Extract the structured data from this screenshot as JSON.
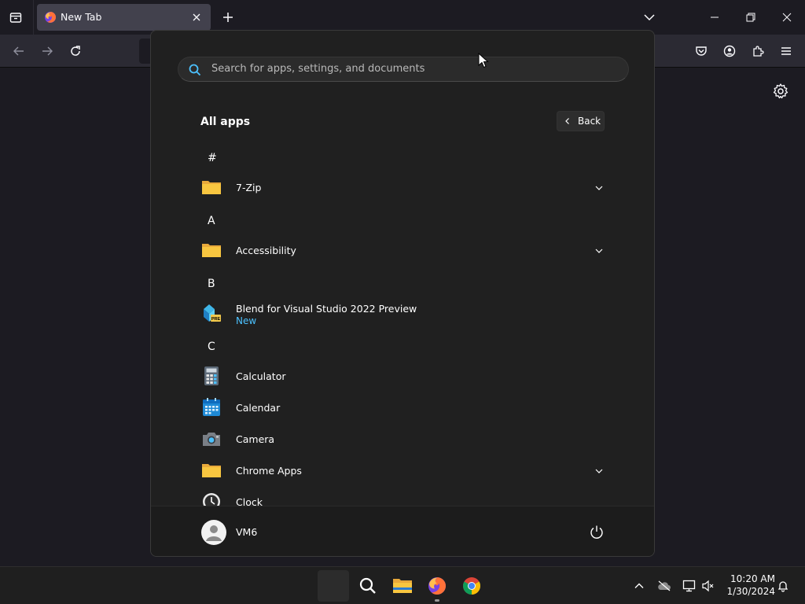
{
  "browser": {
    "tab_title": "New Tab"
  },
  "start_menu": {
    "search_placeholder": "Search for apps, settings, and documents",
    "section_title": "All apps",
    "back_label": "Back",
    "groups": [
      {
        "letter": "#",
        "apps": [
          {
            "name": "7-Zip",
            "icon": "folder-icon",
            "expandable": true
          }
        ]
      },
      {
        "letter": "A",
        "apps": [
          {
            "name": "Accessibility",
            "icon": "folder-icon",
            "expandable": true
          }
        ]
      },
      {
        "letter": "B",
        "apps": [
          {
            "name": "Blend for Visual Studio 2022 Preview",
            "sub": "New",
            "icon": "blend-icon",
            "expandable": false
          }
        ]
      },
      {
        "letter": "C",
        "apps": [
          {
            "name": "Calculator",
            "icon": "calculator-icon",
            "expandable": false
          },
          {
            "name": "Calendar",
            "icon": "calendar-icon",
            "expandable": false
          },
          {
            "name": "Camera",
            "icon": "camera-icon",
            "expandable": false
          },
          {
            "name": "Chrome Apps",
            "icon": "folder-icon",
            "expandable": true
          },
          {
            "name": "Clock",
            "icon": "clock-icon",
            "expandable": false
          }
        ]
      }
    ],
    "user_name": "VM6"
  },
  "taskbar": {
    "time": "10:20 AM",
    "date": "1/30/2024"
  },
  "colors": {
    "accent": "#4cc2ff",
    "menu_bg": "#202020",
    "folder": "#f8c640"
  }
}
